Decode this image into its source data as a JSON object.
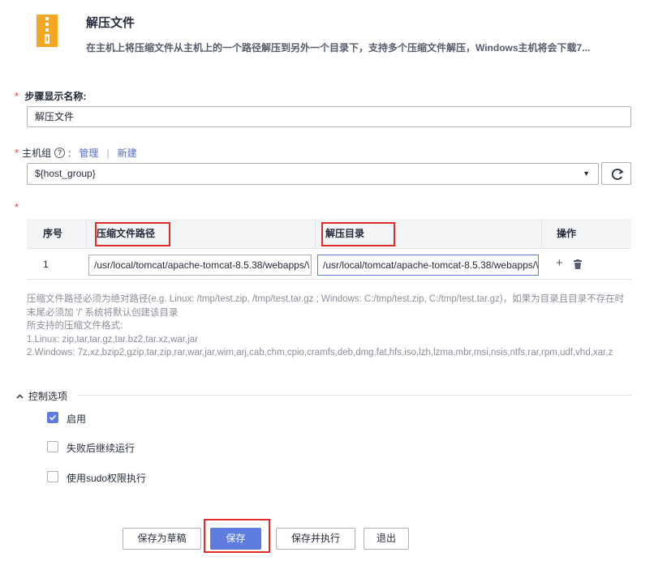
{
  "header": {
    "icon": "zip-file-icon",
    "title": "解压文件",
    "description": "在主机上将压缩文件从主机上的一个路径解压到另外一个目录下，支持多个压缩文件解压，Windows主机将会下载7..."
  },
  "step_name": {
    "required_mark": "*",
    "label": "步骤显示名称:",
    "value": "解压文件"
  },
  "host_group": {
    "required_mark": "*",
    "label": "主机组",
    "manage_link": "管理",
    "separator": "|",
    "new_link": "新建",
    "value": "${host_group}"
  },
  "table": {
    "required_mark": "*",
    "columns": [
      "序号",
      "压缩文件路径",
      "解压目录",
      "操作"
    ],
    "rows": [
      {
        "index": "1",
        "archive_path": "/usr/local/tomcat/apache-tomcat-8.5.38/webapps/\\",
        "extract_dir": "/usr/local/tomcat/apache-tomcat-8.5.38/webapps/\\"
      }
    ],
    "add_symbol": "+"
  },
  "help": {
    "lines": [
      "压缩文件路径必须为绝对路径(e.g. Linux: /tmp/test.zip, /tmp/test.tar.gz ; Windows: C:/tmp/test.zip, C:/tmp/test.tar.gz)，如果为目录且目录不存在时",
      "末尾必须加 '/' 系统将默认创建该目录",
      "所支持的压缩文件格式:",
      "1.Linux: zip,tar,tar.gz,tar.bz2,tar.xz,war,jar",
      "2.Windows: 7z,xz,bzip2,gzip,tar,zip,rar,war,jar,wim,arj,cab,chm,cpio,cramfs,deb,dmg,fat,hfs,iso,lzh,lzma,mbr,msi,nsis,ntfs,rar,rpm,udf,vhd,xar,z"
    ]
  },
  "control": {
    "title": "控制选项",
    "options": [
      {
        "label": "启用",
        "checked": true
      },
      {
        "label": "失败后继续运行",
        "checked": false
      },
      {
        "label": "使用sudo权限执行",
        "checked": false
      }
    ]
  },
  "buttons": {
    "save_draft": "保存为草稿",
    "save": "保存",
    "save_run": "保存并执行",
    "exit": "退出"
  },
  "colors": {
    "primary": "#5e7ce0",
    "highlight": "#e32b2b",
    "required": "#e33c3c",
    "icon": "#f5a623"
  }
}
